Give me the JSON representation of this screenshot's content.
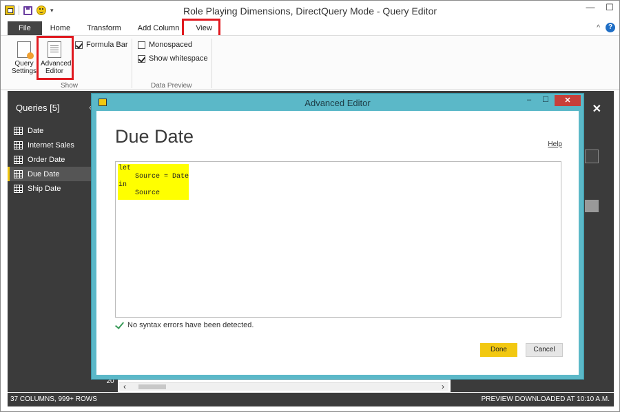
{
  "window": {
    "title": "Role Playing Dimensions, DirectQuery Mode - Query Editor",
    "minimize": "—",
    "maximize": "☐",
    "qat_dropdown": "▾"
  },
  "ribbon": {
    "tabs": [
      "File",
      "Home",
      "Transform",
      "Add Column",
      "View"
    ],
    "collapse_caret": "^",
    "help_icon": "?",
    "show_group": {
      "query_settings_label": "Query Settings",
      "advanced_editor_label": "Advanced Editor",
      "formula_bar_label": "Formula Bar",
      "formula_bar_checked": true,
      "group_label": "Show"
    },
    "data_preview_group": {
      "monospaced_label": "Monospaced",
      "monospaced_checked": false,
      "show_whitespace_label": "Show whitespace",
      "show_whitespace_checked": true,
      "group_label": "Data Preview"
    }
  },
  "queries": {
    "title": "Queries [5]",
    "collapse": "‹",
    "items": [
      "Date",
      "Internet Sales",
      "Order Date",
      "Due Date",
      "Ship Date"
    ],
    "selected": "Due Date"
  },
  "main": {
    "close": "✕",
    "row_number": "20"
  },
  "status": {
    "left": "37 COLUMNS, 999+ ROWS",
    "right": "PREVIEW DOWNLOADED AT 10:10 A.M."
  },
  "dialog": {
    "title": "Advanced Editor",
    "minimize": "–",
    "maximize": "☐",
    "close": "✕",
    "heading": "Due Date",
    "help_link": "Help",
    "code_lines": [
      "let",
      "    Source = Date",
      "in",
      "    Source"
    ],
    "syntax_status": "No syntax errors have been detected.",
    "done_label": "Done",
    "cancel_label": "Cancel"
  },
  "colors": {
    "accent_yellow": "#f2c811",
    "highlight_red": "#e0191f",
    "dialog_frame": "#5bb8c8",
    "dark_pane": "#3b3b3b"
  }
}
